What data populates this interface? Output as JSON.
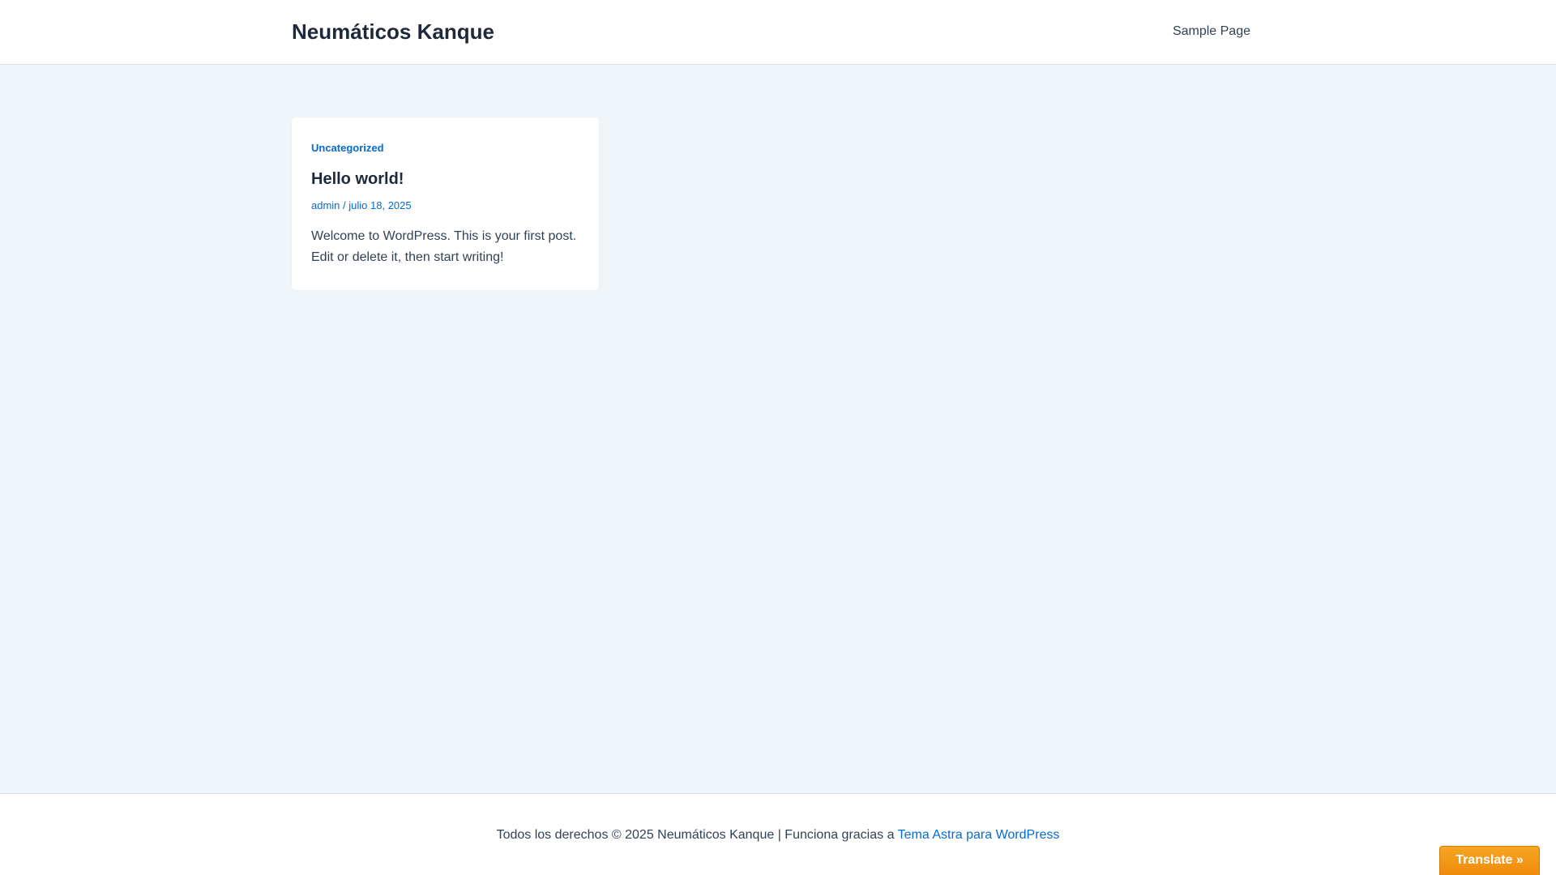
{
  "header": {
    "site_title": "Neumáticos Kanque",
    "nav": [
      {
        "label": "Sample Page"
      }
    ]
  },
  "post": {
    "category": "Uncategorized",
    "title": "Hello world!",
    "author": "admin",
    "separator": "/",
    "date": "julio 18, 2025",
    "excerpt": "Welcome to WordPress. This is your first post. Edit or delete it, then start writing!"
  },
  "footer": {
    "text": "Todos los derechos © 2025 Neumáticos Kanque | Funciona gracias a",
    "link_label": "Tema Astra para WordPress"
  },
  "translate": {
    "label": "Translate »"
  },
  "colors": {
    "accent": "#046BD2",
    "background": "#F0F5FA",
    "translate_button": "#F29A19"
  }
}
